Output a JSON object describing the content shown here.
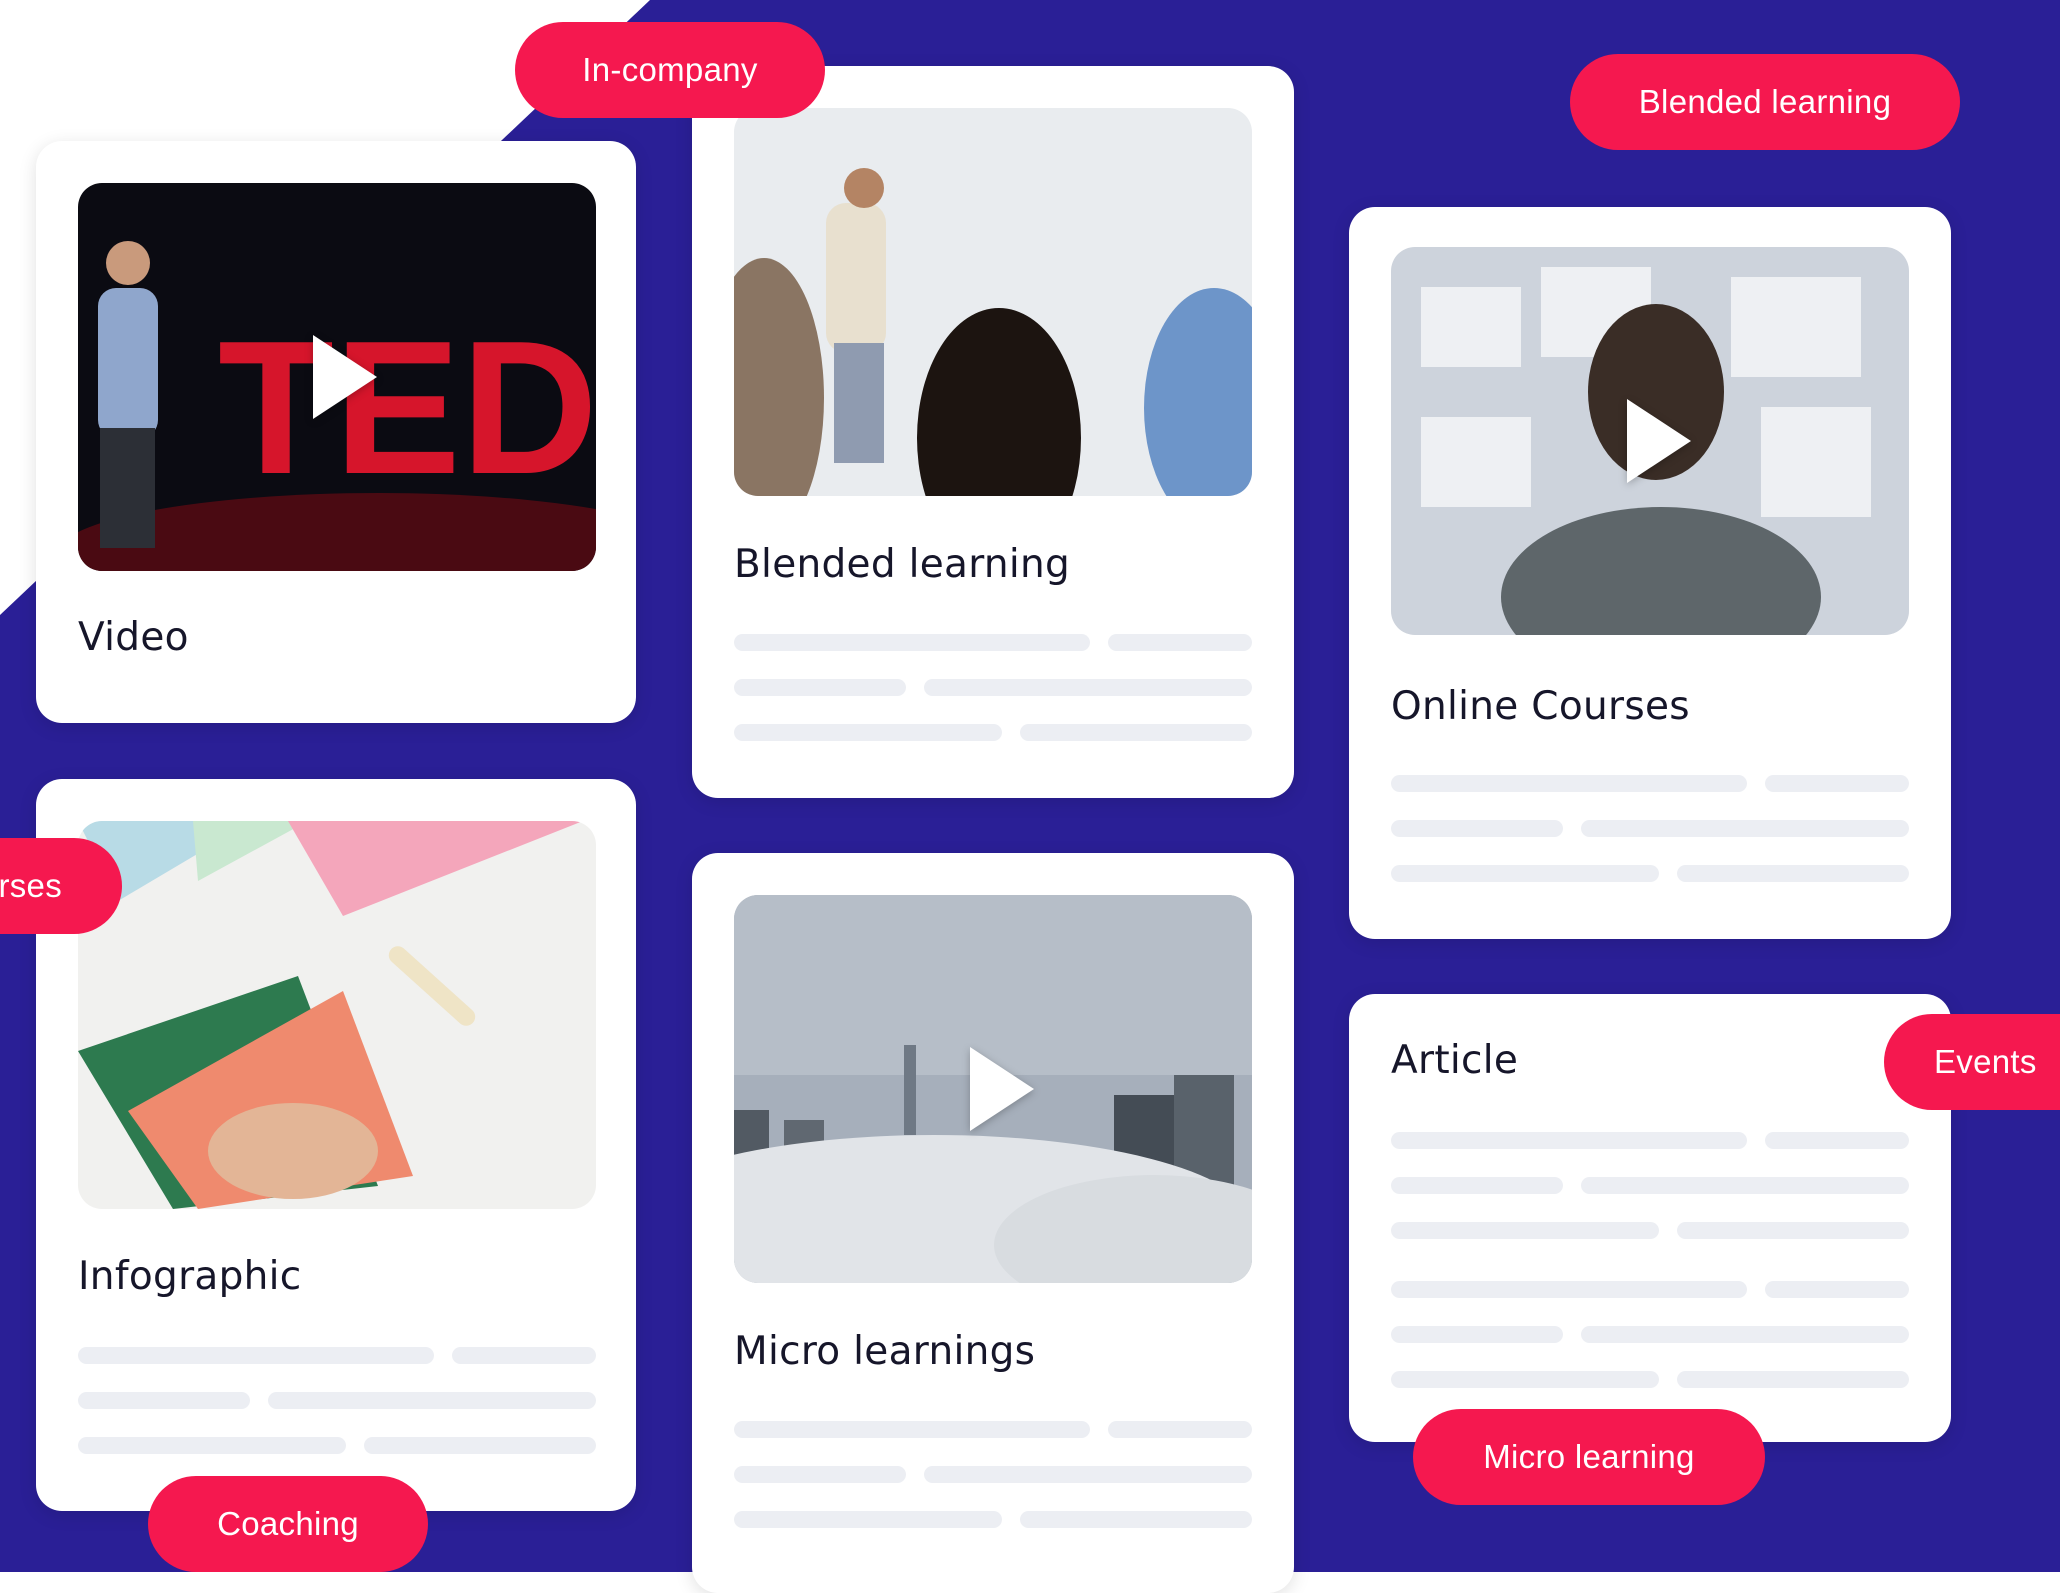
{
  "colors": {
    "background": "#2a1f96",
    "tag": "#f5184f",
    "card": "#ffffff",
    "placeholder": "#eceef3"
  },
  "cards": {
    "video": {
      "title": "Video",
      "icon": "play-icon"
    },
    "blended": {
      "title": "Blended learning"
    },
    "online": {
      "title": "Online Courses",
      "icon": "play-icon"
    },
    "infographic": {
      "title": "Infographic"
    },
    "micro": {
      "title": "Micro learnings",
      "icon": "play-icon"
    },
    "article": {
      "title": "Article"
    }
  },
  "tags": {
    "in_company": "In-company",
    "blended": "Blended learning",
    "courses": "rses",
    "events": "Events",
    "micro": "Micro learning",
    "coaching": "Coaching"
  }
}
